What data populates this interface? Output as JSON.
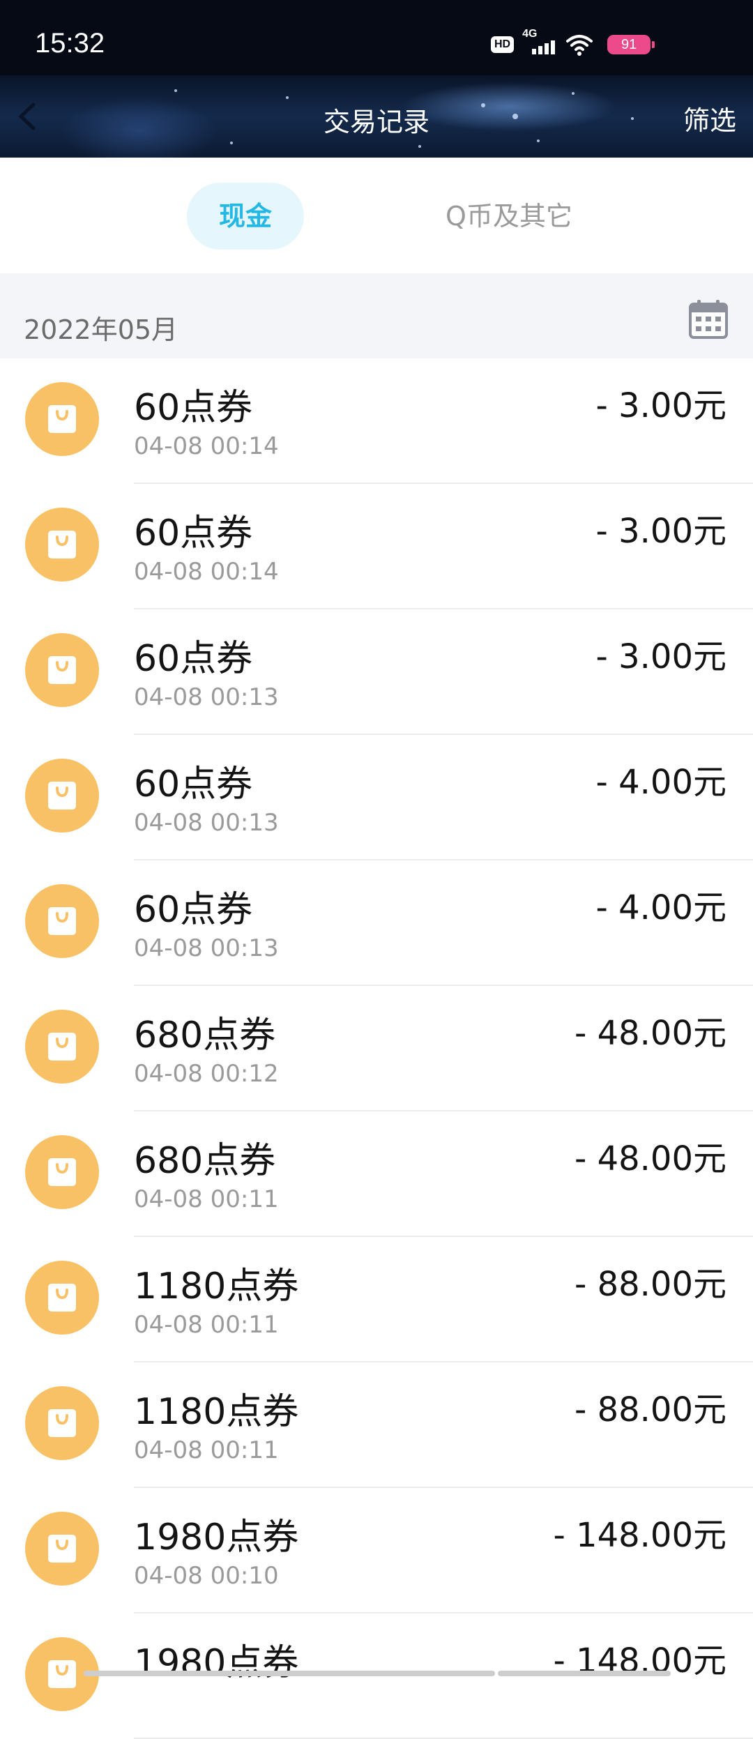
{
  "status_bar": {
    "time": "15:32",
    "hd_badge": "HD",
    "network": "4G",
    "battery": "91",
    "icons": [
      "hd-icon",
      "cellular-signal-icon",
      "wifi-icon",
      "battery-icon"
    ]
  },
  "nav": {
    "title": "交易记录",
    "filter_label": "筛选",
    "back_icon": "chevron-left-icon"
  },
  "tabs": [
    {
      "label": "现金",
      "active": true
    },
    {
      "label": "Q币及其它",
      "active": false
    }
  ],
  "colors": {
    "accent": "#26b8e4",
    "tab_active_bg": "#e5f7fd",
    "icon_bg": "#f9c166",
    "header_bg": "#f4f5f8"
  },
  "month": {
    "label": "2022年05月",
    "calendar_icon": "calendar-icon"
  },
  "transactions": [
    {
      "title": "60点券",
      "time": "04-08 00:14",
      "amount": "- 3.00元"
    },
    {
      "title": "60点券",
      "time": "04-08 00:14",
      "amount": "- 3.00元"
    },
    {
      "title": "60点券",
      "time": "04-08 00:13",
      "amount": "- 3.00元"
    },
    {
      "title": "60点券",
      "time": "04-08 00:13",
      "amount": "- 4.00元"
    },
    {
      "title": "60点券",
      "time": "04-08 00:13",
      "amount": "- 4.00元"
    },
    {
      "title": "680点券",
      "time": "04-08 00:12",
      "amount": "- 48.00元"
    },
    {
      "title": "680点券",
      "time": "04-08 00:11",
      "amount": "- 48.00元"
    },
    {
      "title": "1180点券",
      "time": "04-08 00:11",
      "amount": "- 88.00元"
    },
    {
      "title": "1180点券",
      "time": "04-08 00:11",
      "amount": "- 88.00元"
    },
    {
      "title": "1980点券",
      "time": "04-08 00:10",
      "amount": "- 148.00元"
    },
    {
      "title": "1980点券",
      "time": "",
      "amount": "- 148.00元"
    }
  ],
  "item_icon": "shopping-bag-icon"
}
